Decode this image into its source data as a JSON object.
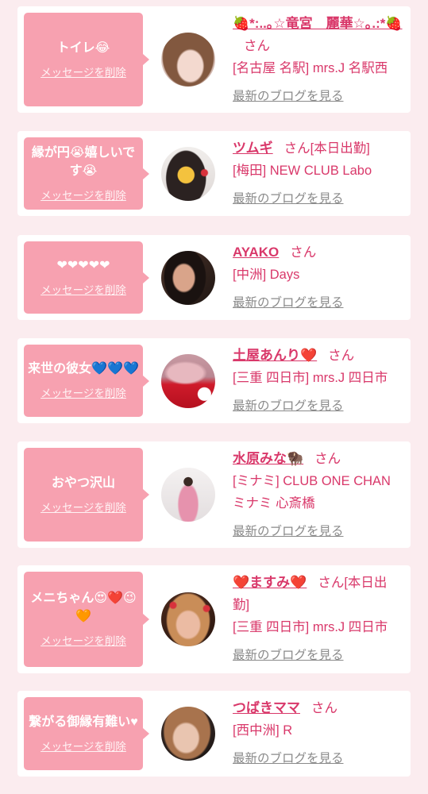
{
  "colors": {
    "background": "#fbecef",
    "card": "#ffffff",
    "bubble": "#f7a1b0",
    "accent": "#d9386a",
    "link_gray": "#8a8a8a"
  },
  "cards": [
    {
      "message": "トイレ😂",
      "delete_label": "メッセージを削除",
      "name": "🍓*:..｡☆竜宮　麗華☆｡.:*🍓",
      "suffix": "さん",
      "location": "[名古屋 名駅] mrs.J 名駅西",
      "blog_label": "最新のブログを見る"
    },
    {
      "message": "縁が円😭嬉しいです😭",
      "delete_label": "メッセージを削除",
      "name": "ツムギ",
      "suffix": "さん",
      "status": "[本日出勤]",
      "location": "[梅田] NEW CLUB Labo",
      "blog_label": "最新のブログを見る"
    },
    {
      "message": "❤❤❤❤❤",
      "delete_label": "メッセージを削除",
      "name": "AYAKO",
      "suffix": "さん",
      "location": "[中洲] Days",
      "blog_label": "最新のブログを見る"
    },
    {
      "message": "来世の彼女💙💙💙",
      "delete_label": "メッセージを削除",
      "name": "土屋あんり❤️",
      "suffix": "さん",
      "location": "[三重 四日市] mrs.J 四日市",
      "blog_label": "最新のブログを見る"
    },
    {
      "message": "おやつ沢山",
      "delete_label": "メッセージを削除",
      "name": "水原みな🦬",
      "suffix": "さん",
      "location": "[ミナミ] CLUB ONE CHAN ミナミ 心斎橋",
      "blog_label": "最新のブログを見る"
    },
    {
      "message": "メニちゃん😍❤️😉🧡",
      "delete_label": "メッセージを削除",
      "name": "❤️ますみ❤️",
      "suffix": "さん",
      "status": "[本日出勤]",
      "location": "[三重 四日市] mrs.J 四日市",
      "blog_label": "最新のブログを見る"
    },
    {
      "message": "繋がる御縁有難い♥",
      "delete_label": "メッセージを削除",
      "name": "つばきママ",
      "suffix": "さん",
      "location": "[西中洲] R",
      "blog_label": "最新のブログを見る"
    }
  ]
}
